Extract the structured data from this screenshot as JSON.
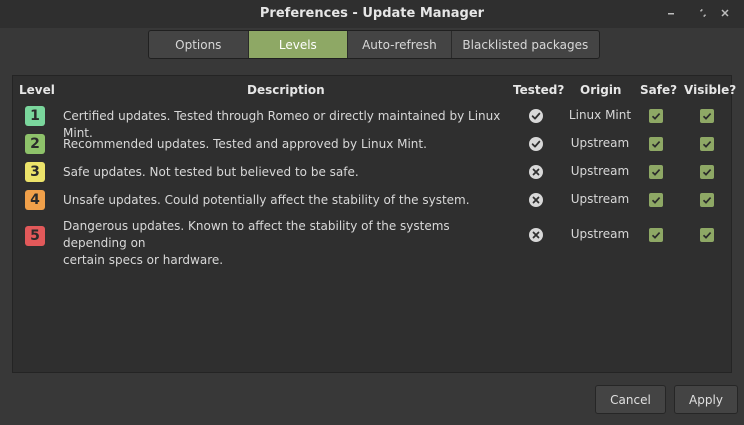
{
  "window": {
    "title": "Preferences - Update Manager"
  },
  "tabs": [
    {
      "label": "Options"
    },
    {
      "label": "Levels"
    },
    {
      "label": "Auto-refresh"
    },
    {
      "label": "Blacklisted packages"
    }
  ],
  "active_tab": "Levels",
  "table": {
    "headers": {
      "level": "Level",
      "description": "Description",
      "tested": "Tested?",
      "origin": "Origin",
      "safe": "Safe?",
      "visible": "Visible?"
    },
    "rows": [
      {
        "level": "1",
        "color": "#7ad69c",
        "description_line1": "Certified updates. Tested through Romeo or directly maintained by Linux Mint.",
        "description_line2": "",
        "tested": true,
        "tested_icon": "check-circle-icon",
        "origin": "Linux Mint",
        "safe": true,
        "visible": true
      },
      {
        "level": "2",
        "color": "#8ec26a",
        "description_line1": "Recommended updates. Tested and approved by Linux Mint.",
        "description_line2": "",
        "tested": true,
        "tested_icon": "check-circle-icon",
        "origin": "Upstream",
        "safe": true,
        "visible": true
      },
      {
        "level": "3",
        "color": "#ece36a",
        "description_line1": "Safe updates. Not tested but believed to be safe.",
        "description_line2": "",
        "tested": false,
        "tested_icon": "x-circle-icon",
        "origin": "Upstream",
        "safe": true,
        "visible": true
      },
      {
        "level": "4",
        "color": "#f0a04a",
        "description_line1": "Unsafe updates. Could potentially affect the stability of the system.",
        "description_line2": "",
        "tested": false,
        "tested_icon": "x-circle-icon",
        "origin": "Upstream",
        "safe": true,
        "visible": true
      },
      {
        "level": "5",
        "color": "#e2595a",
        "description_line1": "Dangerous updates. Known to affect the stability of the systems depending on",
        "description_line2": "certain specs or hardware.",
        "tested": false,
        "tested_icon": "x-circle-icon",
        "origin": "Upstream",
        "safe": true,
        "visible": true
      }
    ]
  },
  "buttons": {
    "cancel": "Cancel",
    "apply": "Apply"
  },
  "colors": {
    "accent": "#8ea865",
    "background": "#383838",
    "panel": "#2f2f2f"
  }
}
